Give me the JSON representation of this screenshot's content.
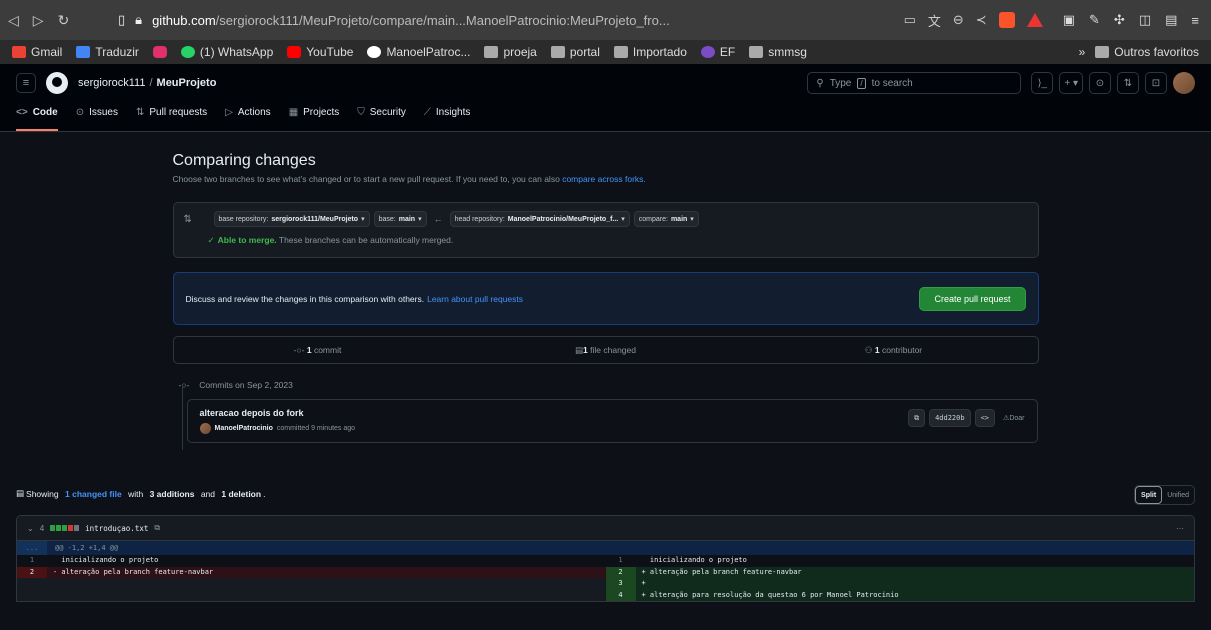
{
  "browser": {
    "url_host": "github.com",
    "url_path": "/sergiorock111/MeuProjeto/compare/main...ManoelPatrocinio:MeuProjeto_fro..."
  },
  "bookmarks": [
    {
      "label": "Gmail",
      "color": "#ea4335"
    },
    {
      "label": "Traduzir",
      "color": "#4285f4"
    },
    {
      "label": "",
      "color": "#e1306c"
    },
    {
      "label": "(1) WhatsApp",
      "color": "#25d366"
    },
    {
      "label": "YouTube",
      "color": "#ff0000"
    },
    {
      "label": "ManoelPatroc...",
      "color": "#ffffff"
    },
    {
      "label": "proeja",
      "color": "#aaaaaa"
    },
    {
      "label": "portal",
      "color": "#aaaaaa"
    },
    {
      "label": "Importado",
      "color": "#aaaaaa"
    },
    {
      "label": "EF",
      "color": "#7b4cc4"
    },
    {
      "label": "smmsg",
      "color": "#aaaaaa"
    }
  ],
  "bookmarks_more": "»",
  "bookmarks_other": "Outros favoritos",
  "header": {
    "owner": "sergiorock111",
    "separator": "/",
    "repo": "MeuProjeto",
    "search_pre": "Type",
    "search_key": "/",
    "search_post": "to search"
  },
  "tabs": [
    {
      "label": "Code",
      "icon": "<>",
      "active": true
    },
    {
      "label": "Issues",
      "icon": "⊙"
    },
    {
      "label": "Pull requests",
      "icon": "⇅"
    },
    {
      "label": "Actions",
      "icon": "▷"
    },
    {
      "label": "Projects",
      "icon": "▦"
    },
    {
      "label": "Security",
      "icon": "⛉"
    },
    {
      "label": "Insights",
      "icon": "⟋"
    }
  ],
  "compare": {
    "title": "Comparing changes",
    "subtitle": "Choose two branches to see what’s changed or to start a new pull request. If you need to, you can also",
    "subtitle_link": "compare across forks.",
    "base_repo_label": "base repository:",
    "base_repo": "sergiorock111/MeuProjeto",
    "base_label": "base:",
    "base": "main",
    "head_repo_label": "head repository:",
    "head_repo": "ManoelPatrocinio/MeuProjeto_f...",
    "compare_label": "compare:",
    "compare": "main",
    "merge_bold": "Able to merge.",
    "merge_text": "These branches can be automatically merged."
  },
  "discuss": {
    "text": "Discuss and review the changes in this comparison with others.",
    "link": "Learn about pull requests",
    "button": "Create pull request"
  },
  "stats": {
    "commits_num": "1",
    "commits_label": "commit",
    "files_num": "1",
    "files_label": "file changed",
    "contrib_num": "1",
    "contrib_label": "contributor"
  },
  "commits": {
    "date_header": "Commits on Sep 2, 2023",
    "title": "alteracao depois do fork",
    "author": "ManoelPatrocinio",
    "meta": "committed 9 minutes ago",
    "sha": "4dd220b",
    "browse": "<>",
    "doar": "Doar"
  },
  "files": {
    "pre": "Showing",
    "link": "1 changed file",
    "mid": "with",
    "additions": "3 additions",
    "and": "and",
    "deletions": "1 deletion",
    "end": ".",
    "split": "Split",
    "unified": "Unified"
  },
  "diff": {
    "count": "4",
    "filename": "introduçao.txt",
    "hunk": "@@ -1,2 +1,4 @@",
    "hunk_expander": "...",
    "more": "···",
    "rows": [
      {
        "l_num": "1",
        "l_code": "  inicializando o projeto",
        "l_type": "ctx",
        "r_num": "1",
        "r_code": "  inicializando o projeto",
        "r_type": "ctx"
      },
      {
        "l_num": "2",
        "l_code": "- alteração pela branch feature-navbar",
        "l_type": "del",
        "r_num": "2",
        "r_code": "+ alteração pela branch feature-navbar",
        "r_type": "add"
      },
      {
        "l_num": "",
        "l_code": "",
        "l_type": "empty",
        "r_num": "3",
        "r_code": "+",
        "r_type": "add"
      },
      {
        "l_num": "",
        "l_code": "",
        "l_type": "empty",
        "r_num": "4",
        "r_code": "+ alteração para resolução da questao 6 por Manoel Patrocinio",
        "r_type": "add"
      }
    ]
  }
}
